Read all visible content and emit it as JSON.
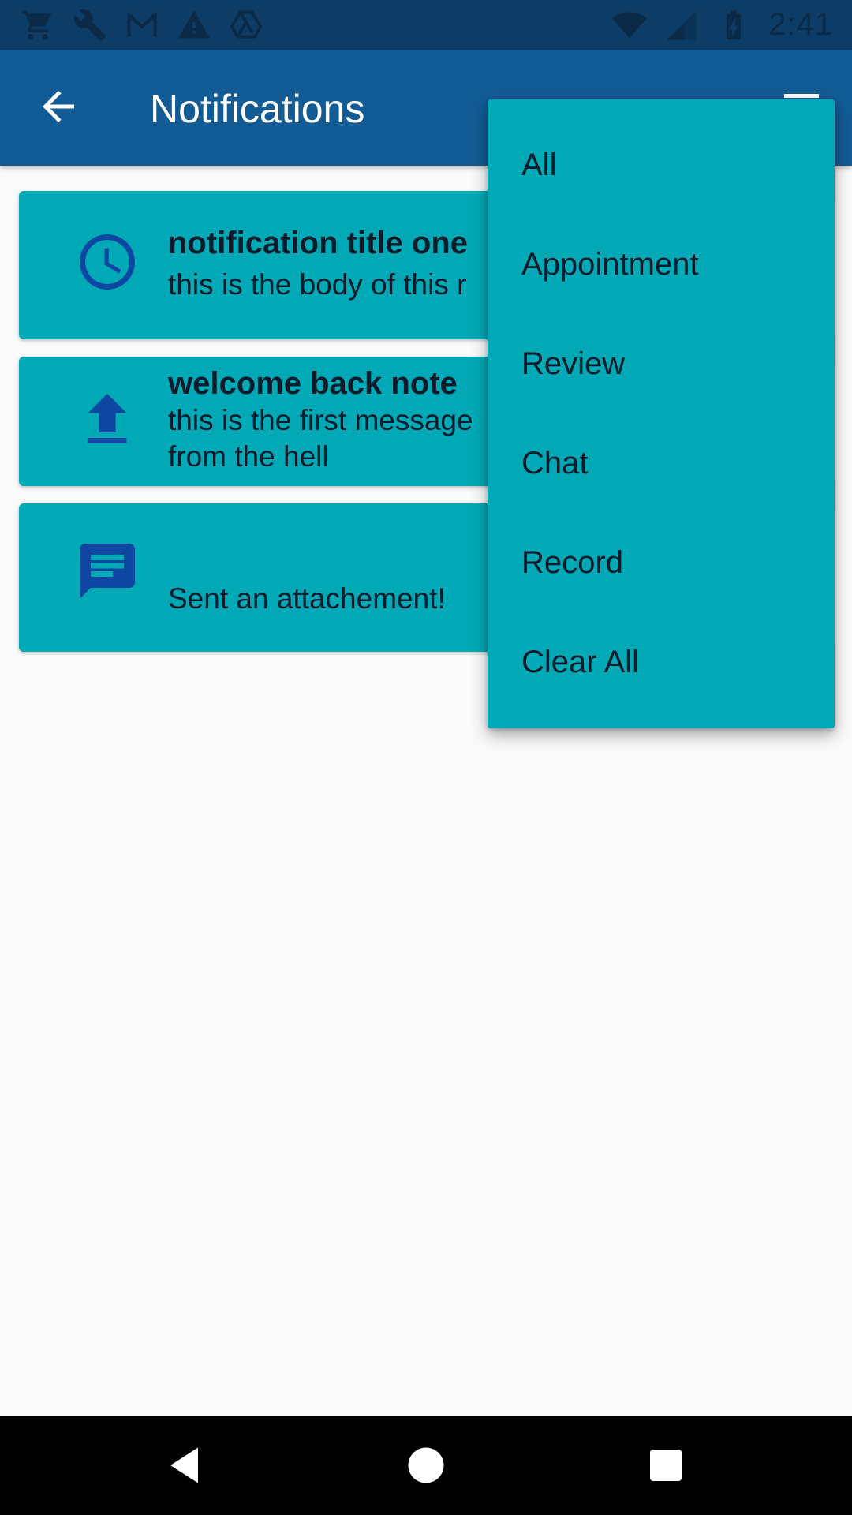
{
  "status_bar": {
    "time": "2:41",
    "left_icons": [
      "cart-icon",
      "wrench-icon",
      "gmail-icon",
      "warning-icon",
      "drive-icon"
    ],
    "right_icons": [
      "wifi-icon",
      "signal-icon",
      "battery-icon"
    ]
  },
  "app_bar": {
    "title": "Notifications",
    "back_icon": "arrow-back-icon",
    "menu_icon": "menu-icon"
  },
  "notifications": [
    {
      "icon": "clock-icon",
      "title": "notification title one",
      "body": "this is the body of this r"
    },
    {
      "icon": "upload-icon",
      "title": "welcome back note",
      "body": "this is the first message\nfrom the hell"
    },
    {
      "icon": "chat-icon",
      "title": "",
      "body": "Sent an attachement!"
    }
  ],
  "menu": {
    "items": [
      "All",
      "Appointment",
      "Review",
      "Chat",
      "Record",
      "Clear All"
    ]
  },
  "colors": {
    "status_bar": "#0d3d66",
    "app_bar": "#125b94",
    "card": "#00a9b5",
    "icon": "#0d47a1",
    "background": "#fafafa"
  }
}
